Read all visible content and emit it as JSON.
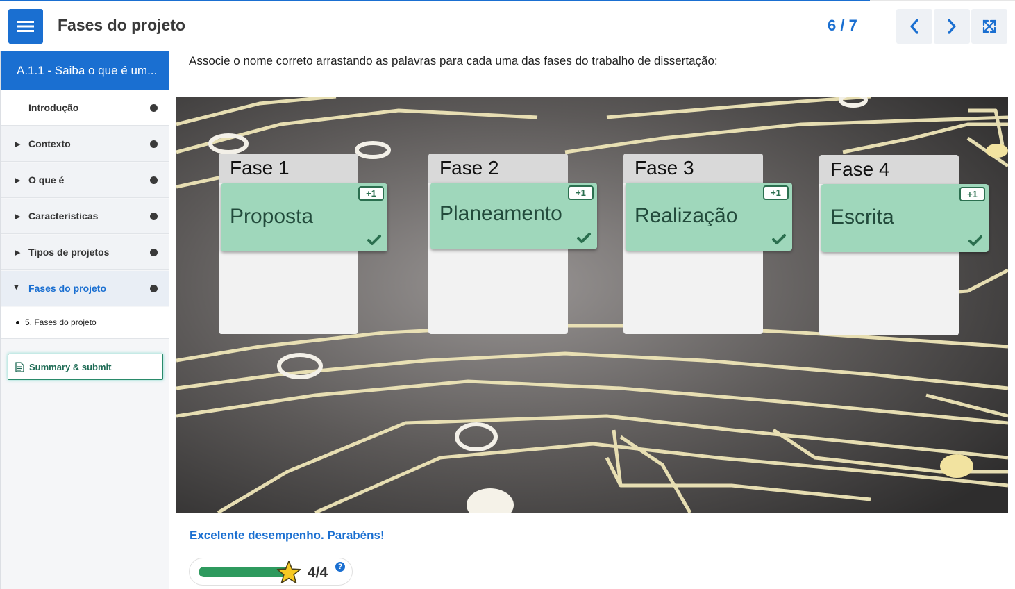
{
  "header": {
    "title": "Fases do projeto",
    "page_counter": "6 / 7",
    "progress_fraction": 0.857,
    "icons": {
      "menu": "hamburger-icon",
      "prev": "chevron-left-icon",
      "next": "chevron-right-icon",
      "fullscreen": "expand-icon"
    }
  },
  "sidebar": {
    "course_title": "A.1.1 - Saiba o que é um...",
    "items": [
      {
        "label": "Introdução",
        "expandable": false
      },
      {
        "label": "Contexto",
        "expandable": true
      },
      {
        "label": "O que é",
        "expandable": true
      },
      {
        "label": "Características",
        "expandable": true
      },
      {
        "label": "Tipos de projetos",
        "expandable": true
      },
      {
        "label": "Fases do projeto",
        "expandable": true,
        "expanded": true,
        "active": true
      }
    ],
    "subitems": [
      {
        "label": "5. Fases do projeto"
      }
    ],
    "submit_label": "Summary & submit"
  },
  "content": {
    "instruction": "Associe o nome correto arrastando as palavras para cada uma das fases do trabalho de dissertação:",
    "zones": [
      {
        "title": "Fase 1",
        "answer": "Proposta",
        "points": "+1",
        "correct": true
      },
      {
        "title": "Fase 2",
        "answer": "Planeamento",
        "points": "+1",
        "correct": true
      },
      {
        "title": "Fase 3",
        "answer": "Realização",
        "points": "+1",
        "correct": true
      },
      {
        "title": "Fase 4",
        "answer": "Escrita",
        "points": "+1",
        "correct": true
      }
    ],
    "feedback": "Excelente desempenho. Parabéns!",
    "score": {
      "text": "4/4",
      "value": 4,
      "max": 4,
      "help": "?"
    }
  },
  "colors": {
    "accent": "#1a6fd1",
    "card": "#9fd7bb",
    "correct": "#2b6f4f",
    "score_fill": "#2e9a5e"
  }
}
